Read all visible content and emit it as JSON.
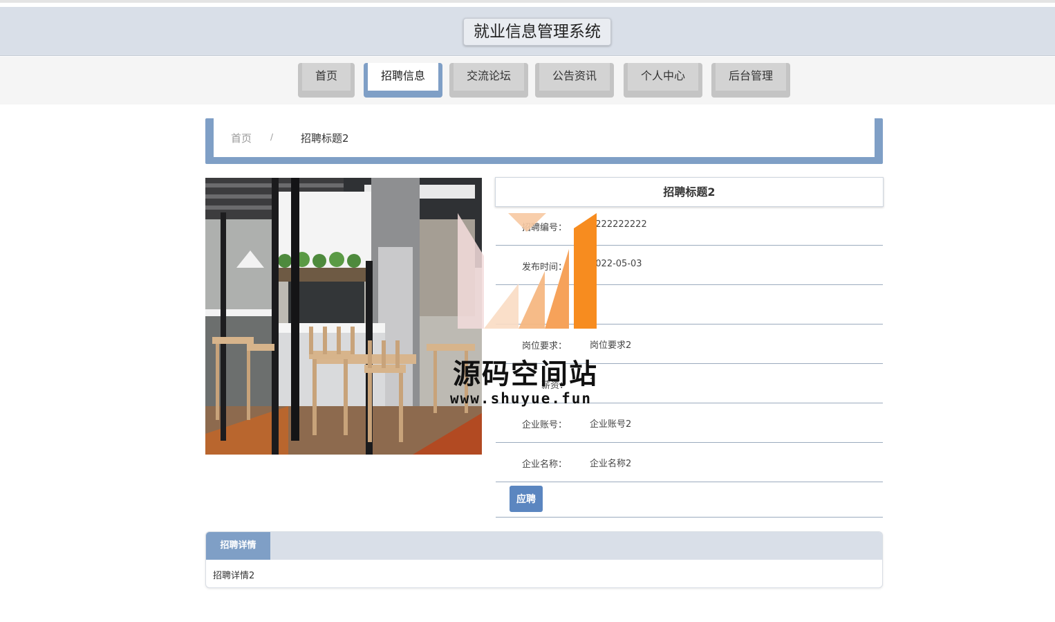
{
  "header": {
    "title": "就业信息管理系统"
  },
  "nav": {
    "items": [
      {
        "label": "首页"
      },
      {
        "label": "招聘信息"
      },
      {
        "label": "交流论坛"
      },
      {
        "label": "公告资讯"
      },
      {
        "label": "个人中心"
      },
      {
        "label": "后台管理"
      }
    ],
    "active": "招聘信息"
  },
  "breadcrumb": {
    "home": "首页",
    "separator": "/",
    "current": "招聘标题2"
  },
  "job": {
    "title": "招聘标题2",
    "fields": [
      {
        "label": "招聘编号：",
        "value": "2222222222"
      },
      {
        "label": "发布时间：",
        "value": "2022-05-03"
      },
      {
        "label": "",
        "value": ""
      },
      {
        "label": "岗位要求：",
        "value": "岗位要求2"
      },
      {
        "label": "薪资：",
        "value": "2"
      },
      {
        "label": "企业账号：",
        "value": "企业账号2"
      },
      {
        "label": "企业名称：",
        "value": "企业名称2"
      }
    ],
    "apply_label": "应聘"
  },
  "details": {
    "tab_label": "招聘详情",
    "content": "招聘详情2"
  },
  "watermark": {
    "text": "源码空间站",
    "url": "www.shuyue.fun"
  },
  "colors": {
    "accent": "#7f9fc6",
    "header_bg": "#d9dfe8",
    "button": "#5b86c0",
    "logo_orange": "#f78c1f"
  }
}
